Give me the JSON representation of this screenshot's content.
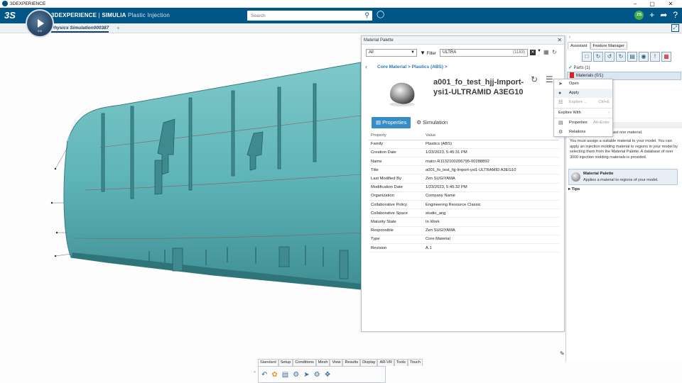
{
  "os": {
    "app_name": "3DEXPERIENCE",
    "min": "–",
    "max": "▢",
    "close": "✕"
  },
  "topbar": {
    "logo": "3S",
    "brand_left": "3DEXPERIENCE",
    "brand_sep": " | ",
    "brand_product": "SIMULIA",
    "brand_app": " Plastic Injection",
    "search_placeholder": "Search",
    "avatar": "ZS"
  },
  "compass": {
    "version": "6.8"
  },
  "tabbar": {
    "tab_label": "Physics Simulation000387",
    "plus": "+"
  },
  "palette": {
    "title": "Material Palette",
    "close": "✕",
    "type_select": "All",
    "filter_label": "Filter",
    "filter_value": "ULTRA",
    "filter_count": "(1183)",
    "breadcrumb": "Core Material > Plastics (ABS) >",
    "material_title": "a001_fo_test_hjj-Import-ysi1-ULTRAMID A3EG10",
    "tab_properties": "Properties",
    "tab_simulation": "Simulation",
    "table_header": {
      "property": "Property",
      "value": "Value"
    },
    "rows": [
      {
        "property": "Family",
        "value": "Plastics (ABS)"
      },
      {
        "property": "Creation Date",
        "value": "1/23/2023, 5:45:31 PM"
      },
      {
        "property": "Name",
        "value": "matcr-R1132100206795-00288892"
      },
      {
        "property": "Title",
        "value": "a001_fo_test_hjj-Import-ysi1-ULTRAMID A3EG10"
      },
      {
        "property": "Last Modified By",
        "value": "Zen SUGIYAMA"
      },
      {
        "property": "Modification Date",
        "value": "1/23/2023, 5:45:32 PM"
      },
      {
        "property": "Organization",
        "value": "Company Name"
      },
      {
        "property": "Collaborative Policy",
        "value": "Engineering Resource Classic"
      },
      {
        "property": "Collaborative Space",
        "value": "studio_ang"
      },
      {
        "property": "Maturity State",
        "value": "In Work"
      },
      {
        "property": "Responsible",
        "value": "Zen SUGIYAMA"
      },
      {
        "property": "Type",
        "value": "Core Material"
      },
      {
        "property": "Revision",
        "value": "A.1"
      }
    ]
  },
  "context_menu": {
    "open": "Open",
    "apply": "Apply",
    "explore": "Explore ...",
    "explore_shortcut": "Ctrl+E",
    "explore_with": "Explore With",
    "properties": "Properties",
    "properties_shortcut": "Alt+Enter",
    "relations": "Relations"
  },
  "assistant": {
    "tab_assistant": "Assistant",
    "tab_feature_manager": "Feature Manager",
    "parts": "Parts (1)",
    "materials": "Materials (0/1)",
    "tail_text": "ith at least one material.",
    "paragraph": "You must assign a suitable material to your model. You can apply an injection molding material to regions in your model by selecting them from the Material Palette. A database of over 3000 injection molding materials is provided.",
    "card_title": "Material Palette",
    "card_desc": "Applies a material to regions of your model.",
    "tips": "Tips"
  },
  "actionbar": {
    "tabs": [
      "Standard",
      "Setup",
      "Conditions",
      "Mesh",
      "View",
      "Results",
      "Display",
      "AR-VR",
      "Tools",
      "Touch"
    ]
  },
  "colors": {
    "topbar": "#005686",
    "model": "#5fb5b8",
    "accent": "#368ec9",
    "link": "#2f77b6"
  }
}
